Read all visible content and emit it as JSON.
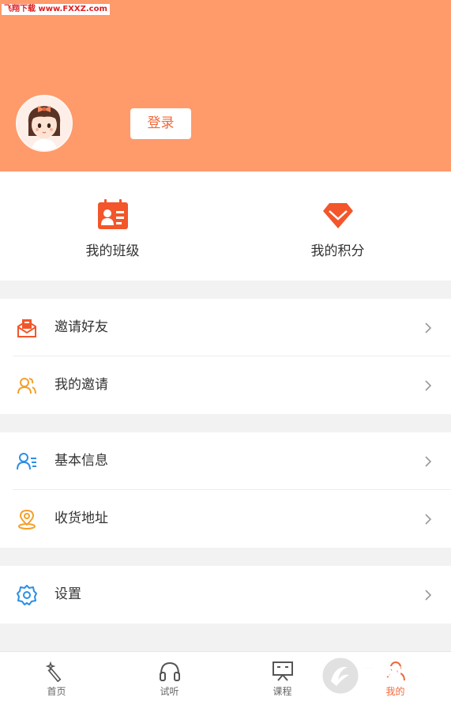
{
  "watermark_text": "飞翔下载 www.FXXZ.com",
  "header": {
    "login_label": "登录",
    "bg_color": "#ff9a6b"
  },
  "quick": [
    {
      "label": "我的班级",
      "icon": "class-card-icon"
    },
    {
      "label": "我的积分",
      "icon": "diamond-icon"
    }
  ],
  "groups": [
    [
      {
        "label": "邀请好友",
        "icon": "invite-envelope-icon"
      },
      {
        "label": "我的邀请",
        "icon": "people-icon"
      }
    ],
    [
      {
        "label": "基本信息",
        "icon": "user-info-icon"
      },
      {
        "label": "收货地址",
        "icon": "location-pin-icon"
      }
    ],
    [
      {
        "label": "设置",
        "icon": "gear-icon"
      }
    ]
  ],
  "tabs": [
    {
      "label": "首页",
      "icon": "magic-wand-icon"
    },
    {
      "label": "试听",
      "icon": "headphones-icon"
    },
    {
      "label": "课程",
      "icon": "blackboard-icon"
    },
    {
      "label": "我的",
      "icon": "profile-icon",
      "active": true
    }
  ],
  "logo_watermark_text": "飞翔下载",
  "accent_color": "#f0683a"
}
